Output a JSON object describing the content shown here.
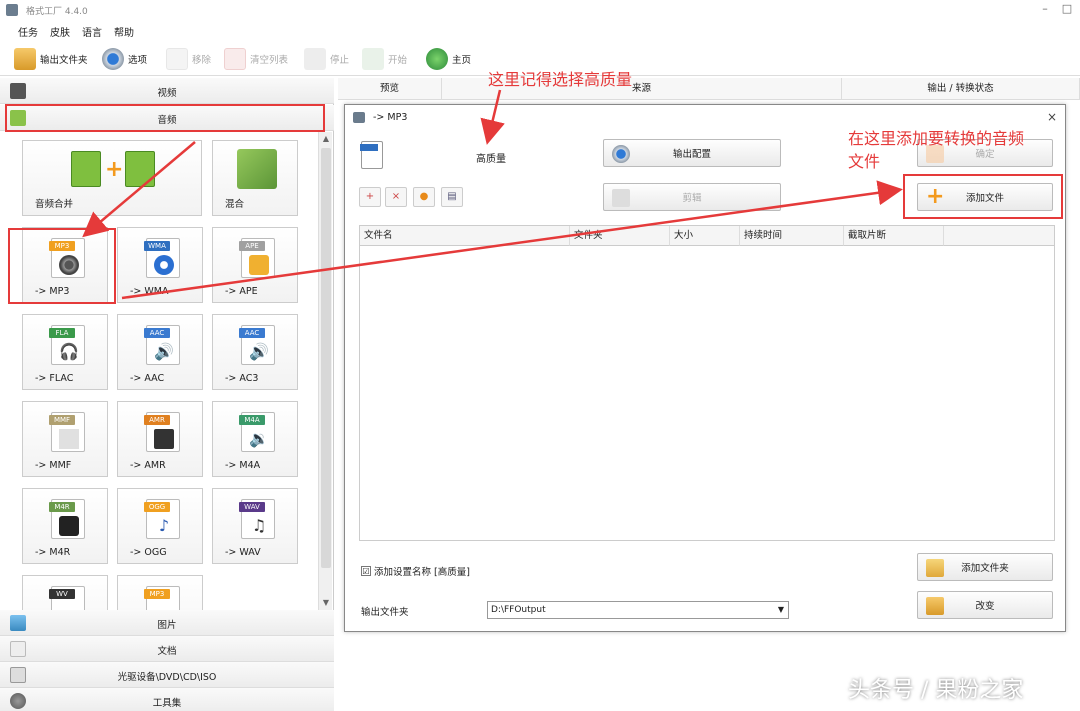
{
  "window": {
    "title": "格式工厂 4.4.0",
    "minimize": "–",
    "maximize": "□"
  },
  "menu": [
    "任务",
    "皮肤",
    "语言",
    "帮助"
  ],
  "toolbar": {
    "output_folder": "输出文件夹",
    "options": "选项",
    "remove": "移除",
    "clear_list": "清空列表",
    "stop": "停止",
    "start": "开始",
    "home": "主页"
  },
  "categories": {
    "video": "视频",
    "audio": "音频",
    "image": "图片",
    "document": "文档",
    "rom": "光驱设备\\DVD\\CD\\ISO",
    "tools": "工具集"
  },
  "tiles": [
    {
      "label": "音频合并",
      "badge": ""
    },
    {
      "label": "混合",
      "badge": ""
    },
    {
      "label": "-> MP3",
      "badge": "MP3"
    },
    {
      "label": "-> WMA",
      "badge": "WMA"
    },
    {
      "label": "-> APE",
      "badge": "APE"
    },
    {
      "label": "-> FLAC",
      "badge": "FLA"
    },
    {
      "label": "-> AAC",
      "badge": "AAC"
    },
    {
      "label": "-> AC3",
      "badge": "AAC"
    },
    {
      "label": "-> MMF",
      "badge": "MMF"
    },
    {
      "label": "-> AMR",
      "badge": "AMR"
    },
    {
      "label": "-> M4A",
      "badge": "M4A"
    },
    {
      "label": "-> M4R",
      "badge": "M4R"
    },
    {
      "label": "-> OGG",
      "badge": "OGG"
    },
    {
      "label": "-> WAV",
      "badge": "WAV"
    },
    {
      "label": "",
      "badge": "WV"
    },
    {
      "label": "",
      "badge": "MP3"
    }
  ],
  "right_columns": {
    "preview": "预览",
    "source": "来源",
    "output_status": "输出 / 转换状态"
  },
  "dialog": {
    "title": "-> MP3",
    "close": "×",
    "quality": "高质量",
    "output_config": "输出配置",
    "ok": "确定",
    "clip": "剪辑",
    "add_file": "添加文件",
    "table_headers": [
      "文件名",
      "文件夹",
      "大小",
      "持续时间",
      "截取片断"
    ],
    "add_setting_name": "添加设置名称 [高质量]",
    "add_setting_checked": "☑",
    "add_folder": "添加文件夹",
    "output_folder_label": "输出文件夹",
    "output_path": "D:\\FFOutput",
    "change": "改变"
  },
  "annotations": {
    "quality_note": "这里记得选择高质量",
    "add_note_line1": "在这里添加要转换的音频",
    "add_note_line2": "文件",
    "color": "#e53a3a"
  },
  "watermark": "头条号 / 果粉之家"
}
